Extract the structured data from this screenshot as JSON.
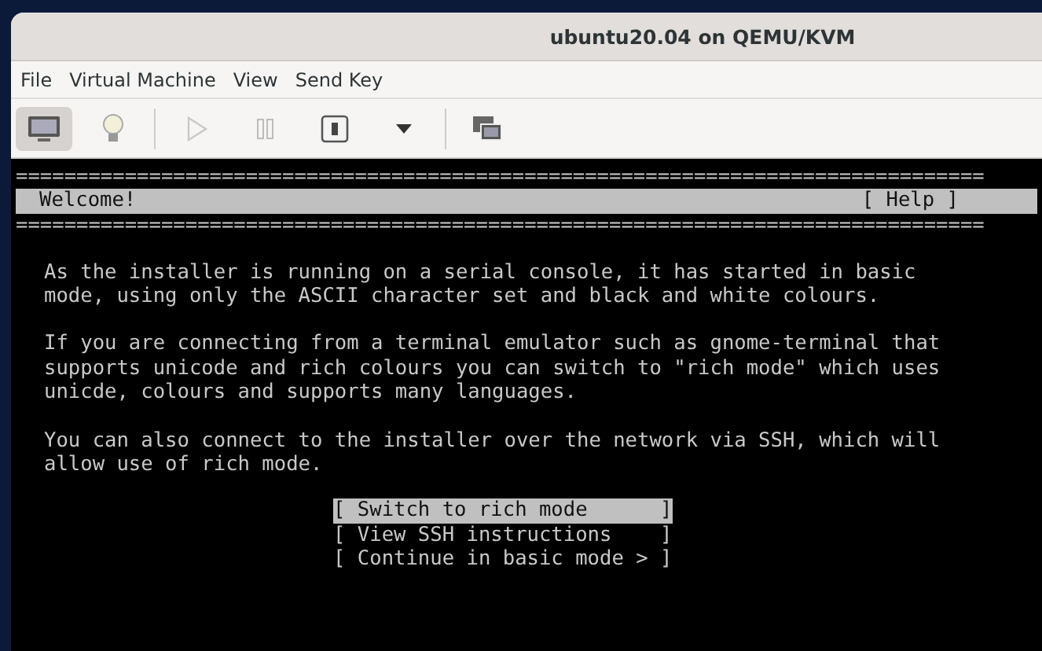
{
  "window": {
    "title": "ubuntu20.04 on QEMU/KVM"
  },
  "menu": [
    "File",
    "Virtual Machine",
    "View",
    "Send Key"
  ],
  "toolbar": [
    [
      {
        "kind": "monitor",
        "selected": true,
        "disabled": false
      },
      {
        "kind": "bulb",
        "selected": false,
        "disabled": false
      }
    ],
    [
      {
        "kind": "play",
        "selected": false,
        "disabled": true
      },
      {
        "kind": "pause",
        "selected": false,
        "disabled": true
      },
      {
        "kind": "power",
        "selected": false,
        "disabled": false
      },
      {
        "kind": "caret",
        "selected": false,
        "disabled": false
      }
    ],
    [
      {
        "kind": "screens",
        "selected": false,
        "disabled": false
      }
    ]
  ],
  "console": {
    "rule": "================================================================================",
    "header": {
      "title": "Welcome!",
      "help": "[ Help ]"
    },
    "paragraphs": [
      [
        "As the installer is running on a serial console, it has started in basic",
        "mode, using only the ASCII character set and black and white colours."
      ],
      [
        "If you are connecting from a terminal emulator such as gnome-terminal that",
        "supports unicode and rich colours you can switch to \"rich mode\" which uses",
        "unicde, colours and supports many languages."
      ],
      [
        "You can also connect to the installer over the network via SSH, which will",
        "allow use of rich mode."
      ]
    ],
    "buttons": [
      {
        "label": "[ Switch to rich mode      ]",
        "selected": true
      },
      {
        "label": "[ View SSH instructions    ]",
        "selected": false
      },
      {
        "label": "[ Continue in basic mode > ]",
        "selected": false
      }
    ]
  }
}
